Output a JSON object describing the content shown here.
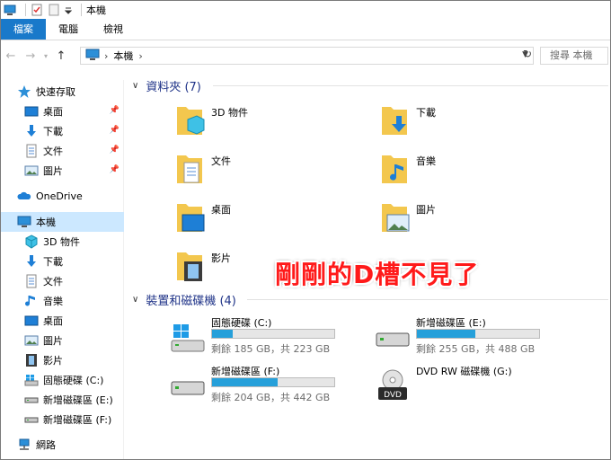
{
  "window": {
    "title": "本機"
  },
  "ribbon": {
    "tabs": [
      "檔案",
      "電腦",
      "檢視"
    ]
  },
  "address": {
    "crumb": "本機",
    "crumb_arrow": "›",
    "search_placeholder": "搜尋 本機"
  },
  "sidebar": {
    "quick_access": "快速存取",
    "quick_items": [
      "桌面",
      "下載",
      "文件",
      "圖片"
    ],
    "onedrive": "OneDrive",
    "this_pc": "本機",
    "pc_items": [
      "3D 物件",
      "下載",
      "文件",
      "音樂",
      "桌面",
      "圖片",
      "影片",
      "固態硬碟 (C:)",
      "新增磁碟區 (E:)",
      "新增磁碟區 (F:)"
    ],
    "network": "網路"
  },
  "folders": {
    "header": "資料夾 (7)",
    "items": [
      "3D 物件",
      "下載",
      "文件",
      "音樂",
      "桌面",
      "圖片",
      "影片"
    ]
  },
  "drives": {
    "header": "裝置和磁碟機 (4)",
    "items": [
      {
        "name": "固態硬碟 (C:)",
        "free": "剩餘 185 GB，共 223 GB",
        "used_fraction": 0.17
      },
      {
        "name": "新增磁碟區 (E:)",
        "free": "剩餘 255 GB，共 488 GB",
        "used_fraction": 0.48
      },
      {
        "name": "新增磁碟區 (F:)",
        "free": "剩餘 204 GB，共 442 GB",
        "used_fraction": 0.54
      },
      {
        "name": "DVD RW 磁碟機 (G:)",
        "dvd_label": "DVD"
      }
    ]
  },
  "annotation": "剛剛的D槽不見了",
  "colors": {
    "accent": "#1979ca",
    "selected": "#cce8ff",
    "header": "#1e3287",
    "bar": "#26a0da",
    "annotation": "#ff1a1a"
  }
}
